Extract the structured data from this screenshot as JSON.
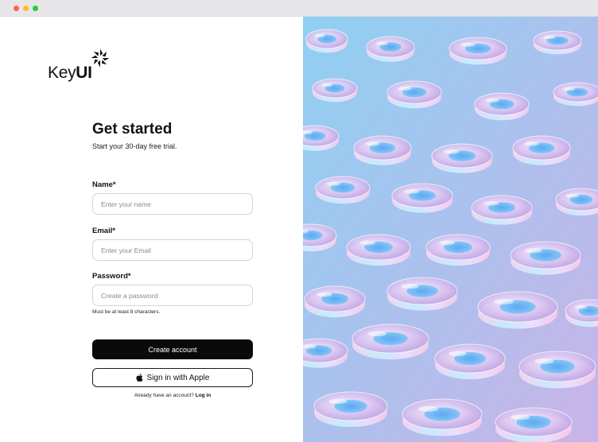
{
  "window": {
    "controls": [
      "close-icon",
      "minimize-icon",
      "maximize-icon"
    ],
    "colors": {
      "close": "#ff5f57",
      "minimize": "#febc2e",
      "maximize": "#28c840"
    }
  },
  "brand": {
    "name_regular": "Key",
    "name_bold": "UI",
    "mark_icon": "aperture-logo-icon"
  },
  "form": {
    "title": "Get started",
    "subtitle": "Start your 30-day free trial.",
    "fields": {
      "name": {
        "label": "Name*",
        "placeholder": "Enter your name",
        "value": ""
      },
      "email": {
        "label": "Email*",
        "placeholder": "Enter your Email",
        "value": ""
      },
      "password": {
        "label": "Password*",
        "placeholder": "Create a password",
        "value": "",
        "hint": "Must be at least 8 characters."
      }
    },
    "create_button": "Create account",
    "apple_button": "Sign in with Apple",
    "apple_icon": "apple-icon",
    "login_prompt": "Already have an account?",
    "login_link": "Log in"
  },
  "hero": {
    "description_icon": "glass-discs-illustration"
  },
  "colors": {
    "primary_button": "#0a0a0b",
    "background": "#ffffff",
    "input_border": "#d4d4d8",
    "hero_sky": "#8fd0f2"
  }
}
